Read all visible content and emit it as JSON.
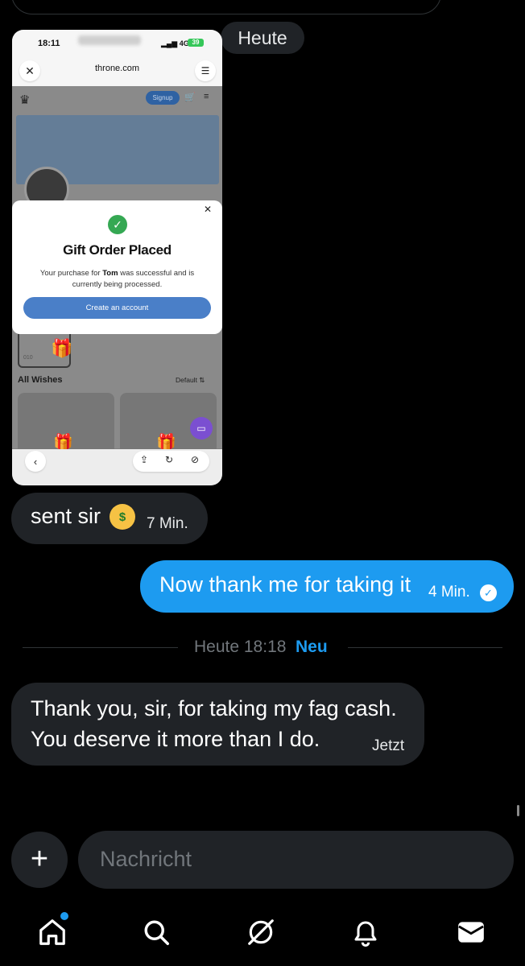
{
  "conversation": {
    "day_label": "Heute",
    "messages": [
      {
        "text": "sent sir",
        "emoji": "🤑",
        "time": "7 Min."
      },
      {
        "text": "Now thank me for taking it",
        "time": "4 Min.",
        "status_icon": "check-circle"
      },
      {
        "line1": "Thank you, sir, for taking my fag cash.",
        "line2": "You deserve it more than I do.",
        "time": "Jetzt"
      }
    ],
    "divider": {
      "time": "Heute 18:18",
      "new_label": "Neu"
    }
  },
  "screenshot": {
    "status_time": "18:11",
    "status_network": "4G",
    "status_battery": "39",
    "url": "throne.com",
    "signup_label": "Signup",
    "modal": {
      "title": "Gift Order Placed",
      "desc_before": "Your purchase for ",
      "desc_name": "Tom",
      "desc_after": " was successful and is currently being processed.",
      "cta_label": "Create an account"
    },
    "card_number": "010",
    "all_wishes_label": "All Wishes",
    "sort_label": "Default ⇅"
  },
  "composer": {
    "placeholder": "Nachricht"
  },
  "nav": {
    "items": [
      "home",
      "search",
      "grok",
      "notifications",
      "messages"
    ]
  },
  "colors": {
    "accent": "#1d9bf0",
    "bubble_incoming": "#202327",
    "background": "#000000"
  }
}
